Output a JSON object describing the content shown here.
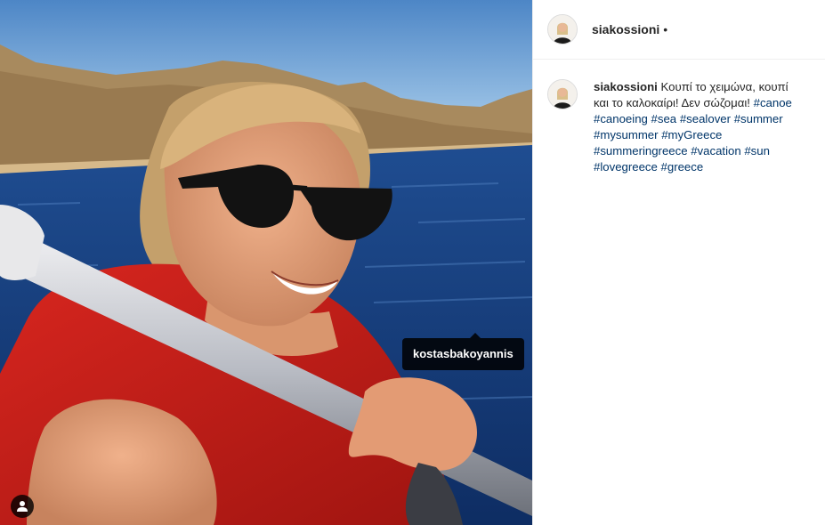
{
  "photo": {
    "tag": "kostasbakoyannis",
    "user_tag_icon": "person-icon"
  },
  "header": {
    "username": "siakossioni",
    "separator": "•"
  },
  "caption": {
    "username": "siakossioni",
    "text": "Κουπί το χειμώνα, κουπί και το καλοκαίρι! Δεν σώζομαι!",
    "hashtags": [
      "#canoe",
      "#canoeing",
      "#sea",
      "#sealover",
      "#summer",
      "#mysummer",
      "#myGreece",
      "#summeringreece",
      "#vacation",
      "#sun",
      "#lovegreece",
      "#greece"
    ]
  },
  "colors": {
    "hashtag": "#003569",
    "text": "#262626",
    "divider": "#efefef"
  }
}
